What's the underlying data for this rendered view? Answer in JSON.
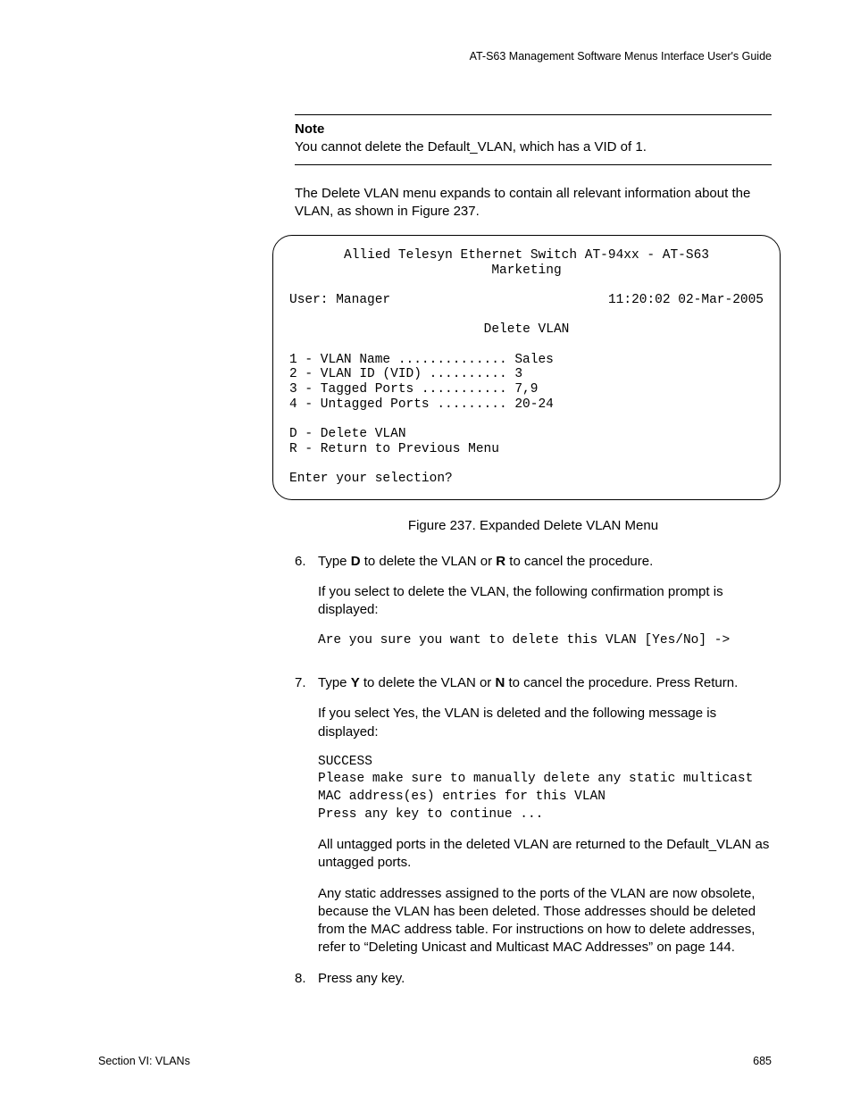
{
  "header": {
    "guide_title": "AT-S63 Management Software Menus Interface User's Guide"
  },
  "note": {
    "label": "Note",
    "text": "You cannot delete the Default_VLAN, which has a VID of 1."
  },
  "intro_para": "The Delete VLAN menu expands to contain all relevant information about the VLAN, as shown in Figure 237.",
  "terminal": {
    "title_line1": "Allied Telesyn Ethernet Switch AT-94xx - AT-S63",
    "title_line2": "Marketing",
    "user_label": "User: Manager",
    "timestamp": "11:20:02 02-Mar-2005",
    "menu_title": "Delete VLAN",
    "items": [
      "1 - VLAN Name .............. Sales",
      "2 - VLAN ID (VID) .......... 3",
      "3 - Tagged Ports ........... 7,9",
      "4 - Untagged Ports ......... 20-24"
    ],
    "actions": [
      "D - Delete VLAN",
      "R - Return to Previous Menu"
    ],
    "prompt": "Enter your selection?"
  },
  "figure_caption": "Figure 237. Expanded Delete VLAN Menu",
  "steps": {
    "s6": {
      "num": "6.",
      "line": {
        "pre": "Type ",
        "k1": "D",
        "mid": " to delete the VLAN or ",
        "k2": "R",
        "post": " to cancel the procedure."
      },
      "follow": "If you select to delete the VLAN, the following confirmation prompt is displayed:",
      "mono": "Are you sure you want to delete this VLAN [Yes/No] ->"
    },
    "s7": {
      "num": "7.",
      "line": {
        "pre": "Type ",
        "k1": "Y",
        "mid": " to delete the VLAN or ",
        "k2": "N",
        "post": " to cancel the procedure. Press Return."
      },
      "follow": "If you select Yes, the VLAN is deleted and the following message is displayed:",
      "mono": "SUCCESS\nPlease make sure to manually delete any static multicast\nMAC address(es) entries for this VLAN\nPress any key to continue ...",
      "para2": "All untagged ports in the deleted VLAN are returned to the Default_VLAN as untagged ports.",
      "para3": "Any static addresses assigned to the ports of the VLAN are now obsolete, because the VLAN has been deleted. Those addresses should be deleted from the MAC address table. For instructions on how to delete addresses, refer to “Deleting Unicast and Multicast MAC Addresses” on page 144."
    },
    "s8": {
      "num": "8.",
      "line": "Press any key."
    }
  },
  "footer": {
    "section": "Section VI: VLANs",
    "page": "685"
  }
}
